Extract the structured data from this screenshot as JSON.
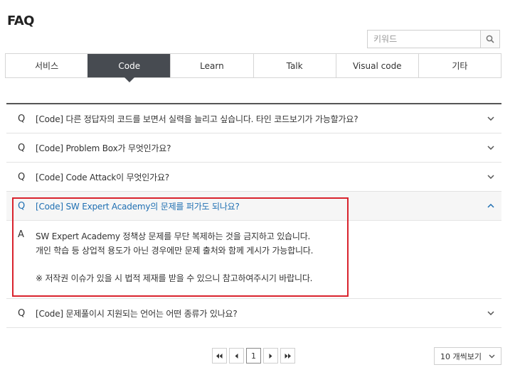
{
  "page": {
    "title": "FAQ"
  },
  "search": {
    "placeholder": "키워드",
    "value": ""
  },
  "tabs": [
    {
      "label": "서비스",
      "active": false
    },
    {
      "label": "Code",
      "active": true
    },
    {
      "label": "Learn",
      "active": false
    },
    {
      "label": "Talk",
      "active": false
    },
    {
      "label": "Visual code",
      "active": false
    },
    {
      "label": "기타",
      "active": false
    }
  ],
  "faq": {
    "q_mark": "Q",
    "a_mark": "A",
    "items": [
      {
        "question": "[Code] 다른 정답자의 코드를 보면서 실력을 늘리고 싶습니다. 타인 코드보기가 가능할가요?",
        "open": false
      },
      {
        "question": "[Code] Problem Box가 무엇인가요?",
        "open": false
      },
      {
        "question": "[Code] Code Attack이 무엇인가요?",
        "open": false
      },
      {
        "question": "[Code] SW Expert Academy의 문제를 퍼가도 되나요?",
        "open": true,
        "answer": {
          "line1": "SW Expert Academy 정책상 문제를 무단 복제하는 것을 금지하고 있습니다.",
          "line2": "개인 학습 등 상업적 용도가 아닌 경우에만 문제 출처와 함께 게시가 가능합니다.",
          "line3": "※ 저작권 이슈가 있을 시 법적 제재를 받을 수 있으니 참고하여주시기 바랍니다."
        }
      },
      {
        "question": "[Code] 문제풀이시 지원되는 언어는 어떤 종류가 있나요?",
        "open": false
      }
    ]
  },
  "pagination": {
    "current_page": "1"
  },
  "per_page": {
    "selected": "10 개씩보기"
  },
  "colors": {
    "active_tab": "#474b51",
    "open_question": "#1f6fb2",
    "highlight_box": "#d9232d"
  }
}
